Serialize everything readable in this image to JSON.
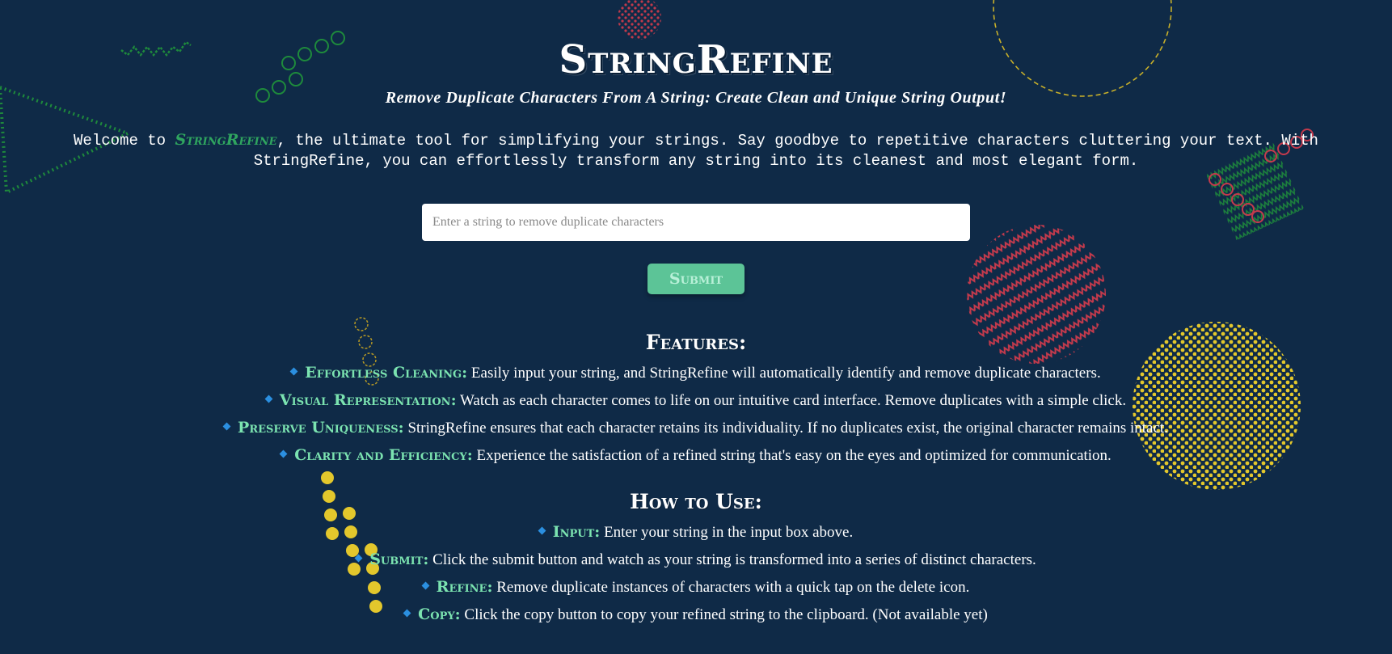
{
  "app": {
    "title": "StringRefine",
    "subtitle": "Remove Duplicate Characters From A String: Create Clean and Unique String Output!"
  },
  "intro": {
    "prefix": "Welcome to ",
    "brand": "StringRefine",
    "suffix": ", the ultimate tool for simplifying your strings. Say goodbye to repetitive characters cluttering your text. With StringRefine, you can effortlessly transform any string into its cleanest and most elegant form."
  },
  "form": {
    "input_value": "",
    "input_placeholder": "Enter a string to remove duplicate characters",
    "submit_label": "Submit"
  },
  "features": {
    "heading": "Features:",
    "items": [
      {
        "term": "Effortless Cleaning:",
        "desc": " Easily input your string, and StringRefine will automatically identify and remove duplicate characters."
      },
      {
        "term": "Visual Representation:",
        "desc": " Watch as each character comes to life on our intuitive card interface. Remove duplicates with a simple click."
      },
      {
        "term": "Preserve Uniqueness:",
        "desc": " StringRefine ensures that each character retains its individuality. If no duplicates exist, the original character remains intact."
      },
      {
        "term": "Clarity and Efficiency:",
        "desc": " Experience the satisfaction of a refined string that's easy on the eyes and optimized for communication."
      }
    ]
  },
  "how_to": {
    "heading": "How to Use:",
    "items": [
      {
        "term": "Input:",
        "desc": " Enter your string in the input box above."
      },
      {
        "term": "Submit:",
        "desc": " Click the submit button and watch as your string is transformed into a series of distinct characters."
      },
      {
        "term": "Refine:",
        "desc": " Remove duplicate instances of characters with a quick tap on the delete icon."
      },
      {
        "term": "Copy:",
        "desc": " Click the copy button to copy your refined string to the clipboard. (Not available yet)"
      }
    ]
  },
  "colors": {
    "background": "#0f2a47",
    "accent_green": "#7be3b0",
    "brand_green": "#2fa55f",
    "bullet_blue": "#2b8fe0",
    "button": "#5cc497"
  }
}
